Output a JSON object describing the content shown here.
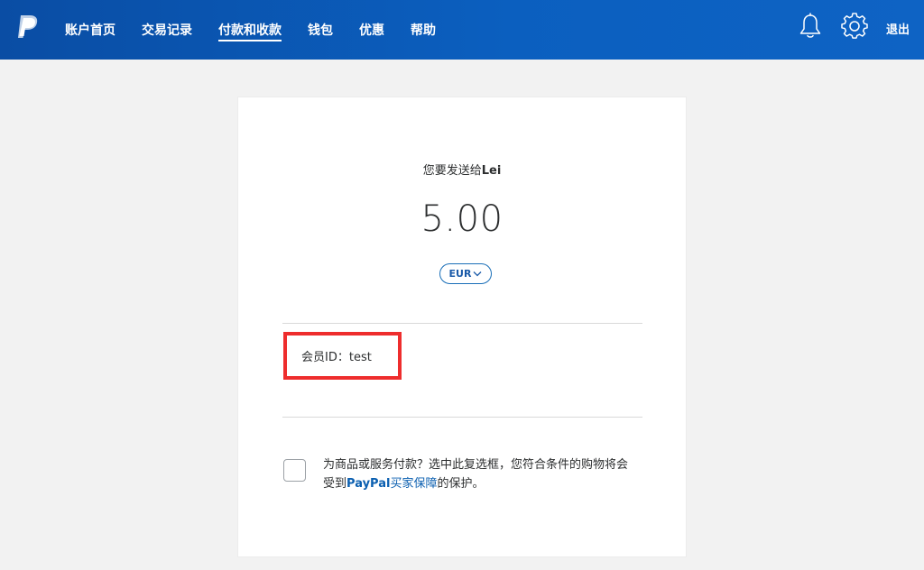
{
  "header": {
    "nav": [
      "账户首页",
      "交易记录",
      "付款和收款",
      "钱包",
      "优惠",
      "帮助"
    ],
    "active_index": 2,
    "logout": "退出",
    "icons": [
      "paypal-logo-icon",
      "bell-icon",
      "gear-icon"
    ]
  },
  "payment": {
    "send_prefix": "您要发送给",
    "recipient": "Lei",
    "amount": "5.00",
    "currency": "EUR",
    "member_id": "会员ID：test"
  },
  "protection": {
    "text_before": "为商品或服务付款？选中此复选框，您符合条件的购物将会受到",
    "brand": "PayPal",
    "link_text": "买家保障",
    "text_after": "的保护。",
    "checked": false
  },
  "colors": {
    "header_bg": "#0b5fbf",
    "link": "#0b5fb0",
    "highlight_border": "#ee2d2d",
    "page_bg": "#f2f2f2"
  }
}
